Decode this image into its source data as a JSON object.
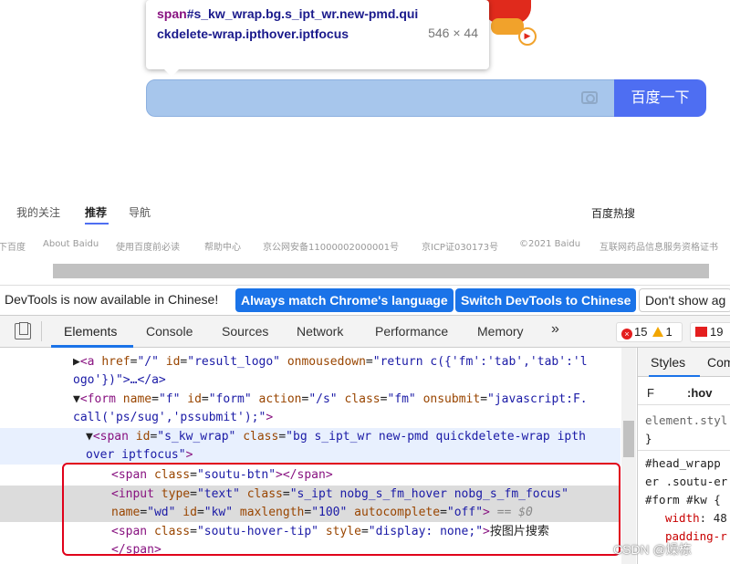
{
  "tooltip": {
    "selector_tag": "span",
    "selector_rest": "#s_kw_wrap.bg.s_ipt_wr.new-pmd.quickdelete-wrap.ipthover.iptfocus",
    "dimensions": "546 × 44"
  },
  "search": {
    "button_label": "百度一下",
    "camera_icon": "camera-icon"
  },
  "nav": {
    "tab_follow": "我的关注",
    "tab_recommend": "推荐",
    "tab_nav": "导航",
    "hot_search": "百度热搜"
  },
  "footer": {
    "items": [
      "下百度",
      "About Baidu",
      "使用百度前必读",
      "帮助中心",
      "京公网安备11000002000001号",
      "京ICP证030173号",
      "©2021 Baidu",
      "互联网药品信息服务资格证书"
    ]
  },
  "banner": {
    "message": "DevTools is now available in Chinese!",
    "btn_match": "Always match Chrome's language",
    "btn_switch": "Switch DevTools to Chinese",
    "btn_dont_show": "Don't show ag"
  },
  "devtools": {
    "tabs": [
      "Elements",
      "Console",
      "Sources",
      "Network",
      "Performance",
      "Memory"
    ],
    "more": "»",
    "errors": "15",
    "warnings": "1",
    "issues": "19"
  },
  "dom": {
    "l1_text": "ogo'})\">…</a>",
    "l2": {
      "tag": "<form",
      "a1": "name",
      "v1": "\"f\"",
      "a2": "id",
      "v2": "\"form\"",
      "a3": "action",
      "v3": "\"/s\"",
      "a4": "class",
      "v4": "\"fm\"",
      "a5": "onsubmit",
      "v5": "\"javascript:F.",
      "cont": "call('ps/sug','pssubmit');\"",
      "end": ">"
    },
    "l3": {
      "tag": "<span",
      "a1": "id",
      "v1": "\"s_kw_wrap\"",
      "a2": "class",
      "v2": "\"bg s_ipt_wr new-pmd quickdelete-wrap ipth",
      "cont": "over iptfocus\"",
      "end": ">"
    },
    "l4": {
      "tag": "<span",
      "a1": "class",
      "v1": "\"soutu-btn\"",
      "end": "></span>"
    },
    "l5": {
      "tag": "<input",
      "a1": "type",
      "v1": "\"text\"",
      "a2": "class",
      "v2": "\"s_ipt nobg_s_fm_hover nobg_s_fm_focus\"",
      "a3": "name",
      "v3": "\"wd\"",
      "a4": "id",
      "v4": "\"kw\"",
      "a5": "maxlength",
      "v5": "\"100\"",
      "a6": "autocomplete",
      "v6": "\"off\"",
      "end": ">",
      "eq": " == $0"
    },
    "l6": {
      "tag": "<span",
      "a1": "class",
      "v1": "\"soutu-hover-tip\"",
      "a2": "style",
      "v2": "\"display: none;\"",
      "end": ">",
      "text": "按图片搜索"
    },
    "l7": "</span>",
    "l0": {
      "tag": "<a",
      "a1": "href",
      "v1": "\"/\"",
      "a2": "id",
      "v2": "\"result_logo\"",
      "a3": "onmousedown",
      "v3": "\"return c({'fm':'tab','tab':'l"
    }
  },
  "styles": {
    "tab_styles": "Styles",
    "tab_computed": "Com",
    "filter": "F",
    "hov": ":hov",
    "l1": "element.styl",
    "l2": "}",
    "l3": "#head_wrapp",
    "l4": "er .soutu-er",
    "l5": "#form #kw {",
    "l6_prop": "width",
    "l6_val": "48",
    "l7": "padding-r"
  },
  "watermark": "CSDN @燥栋"
}
